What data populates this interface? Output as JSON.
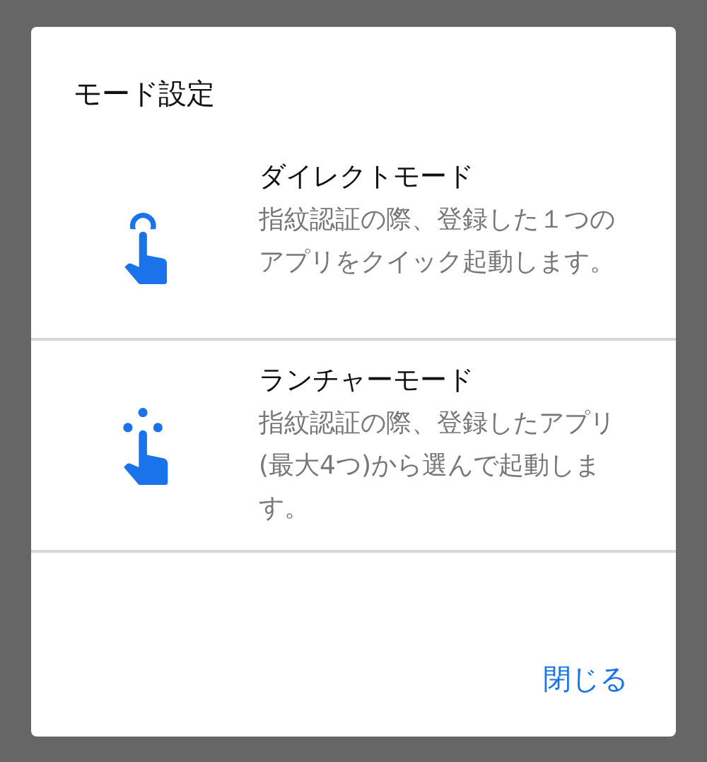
{
  "dialog": {
    "title": "モード設定",
    "options": [
      {
        "kind": "tap",
        "name": "ダイレクトモード",
        "description": "指紋認証の際、登録した１つのアプリをクイック起動します。"
      },
      {
        "kind": "multi_tap",
        "name": "ランチャーモード",
        "description": "指紋認証の際、登録したアプリ(最大4つ)から選んで起動します。"
      }
    ],
    "close_button": "閉じる"
  }
}
